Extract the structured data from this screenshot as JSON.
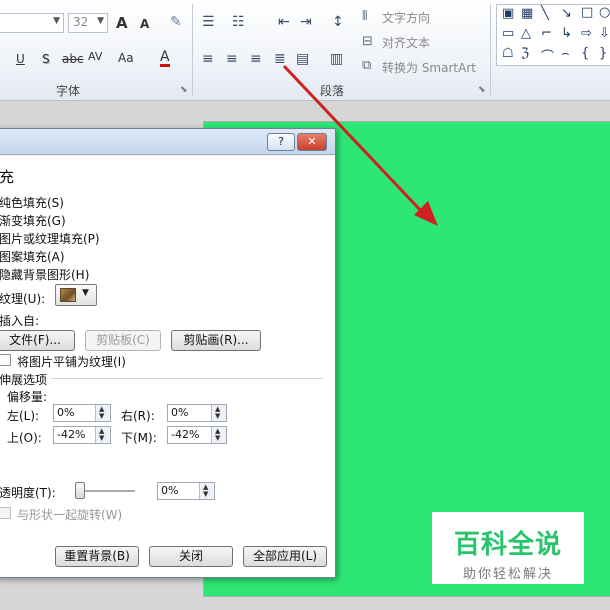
{
  "ribbon": {
    "font_size_value": "32",
    "grow_font_label": "A",
    "shrink_font_label": "A",
    "underline_label": "U",
    "shadow_label": "S",
    "strikethrough_label": "abc",
    "spacing_label": "AV",
    "case_label": "Aa",
    "font_color_label": "A",
    "font_group_label": "字体",
    "paragraph_group_label": "段落",
    "text_direction_label": "文字方向",
    "align_text_label": "对齐文本",
    "smartart_label": "转换为 SmartArt"
  },
  "dialog": {
    "title_help": "?",
    "title_close": "✕",
    "section_fill": "充",
    "opt_solid": "纯色填充(S)",
    "opt_gradient": "渐变填充(G)",
    "opt_picture": "图片或纹理填充(P)",
    "opt_pattern": "图案填充(A)",
    "opt_hide_bg": "隐藏背景图形(H)",
    "texture_label": "纹理(U):",
    "insert_from": "插入自:",
    "btn_file": "文件(F)...",
    "btn_clipboard": "剪贴板(C)",
    "btn_clipart": "剪贴画(R)...",
    "tile_label": "将图片平铺为纹理(I)",
    "stretch_label": "伸展选项",
    "offset_label": "偏移量:",
    "left_label": "左(L):",
    "left_value": "0%",
    "right_label": "右(R):",
    "right_value": "0%",
    "top_label": "上(O):",
    "top_value": "-42%",
    "bottom_label": "下(M):",
    "bottom_value": "-42%",
    "transparency_label": "透明度(T):",
    "transparency_value": "0%",
    "rotate_label": "与形状一起旋转(W)",
    "btn_reset": "重置背景(B)",
    "btn_close": "关闭",
    "btn_apply_all": "全部应用(L)"
  },
  "watermark": {
    "title": "百科全说",
    "subtitle": "助你轻松解决"
  },
  "colors": {
    "slide": "#2ee676",
    "arrow": "#d02020",
    "watermark_title": "#27c46b"
  }
}
